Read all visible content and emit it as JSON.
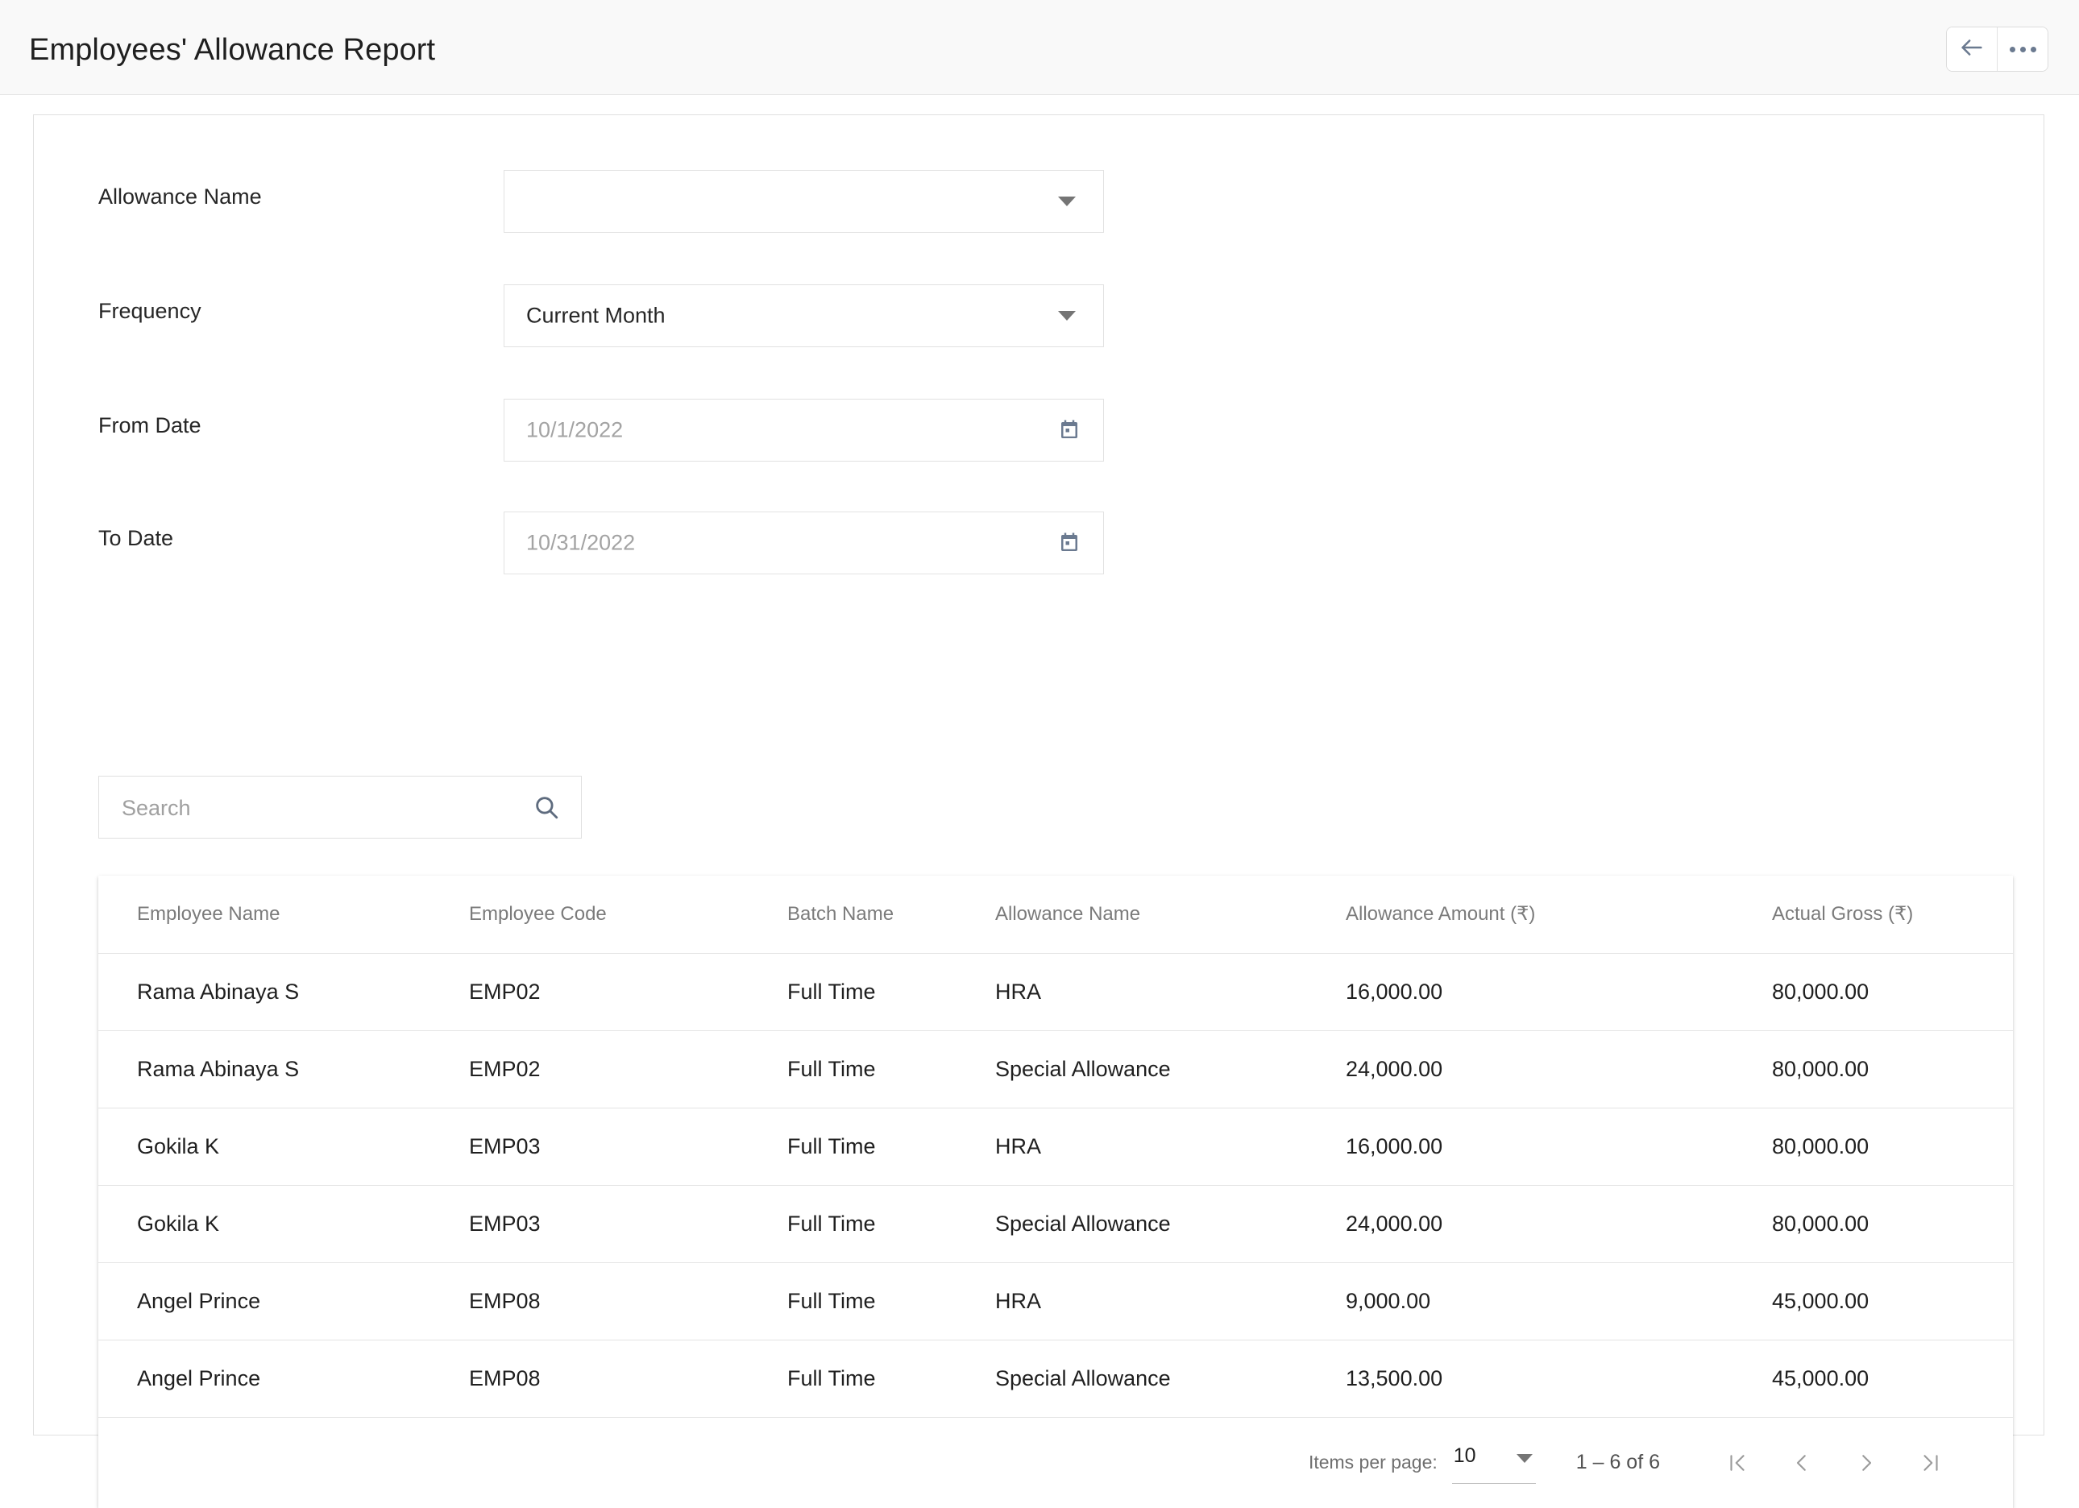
{
  "header": {
    "title": "Employees' Allowance Report",
    "back_button": "back-arrow",
    "more_button": "more-options"
  },
  "filters": [
    {
      "label": "Allowance Name",
      "type": "select",
      "value": "",
      "placeholder": ""
    },
    {
      "label": "Frequency",
      "type": "select",
      "value": "Current Month",
      "placeholder": ""
    },
    {
      "label": "From Date",
      "type": "date",
      "value": "",
      "placeholder": "10/1/2022"
    },
    {
      "label": "To Date",
      "type": "date",
      "value": "",
      "placeholder": "10/31/2022"
    }
  ],
  "search": {
    "placeholder": "Search",
    "value": "",
    "icon": "search-icon"
  },
  "table": {
    "columns": [
      "Employee Name",
      "Employee Code",
      "Batch Name",
      "Allowance Name",
      "Allowance Amount (₹)",
      "Actual Gross (₹)"
    ],
    "rows": [
      {
        "employee_name": "Rama Abinaya S",
        "employee_code": "EMP02",
        "batch_name": "Full Time",
        "allowance_name": "HRA",
        "allowance_amount": "16,000.00",
        "actual_gross": "80,000.00"
      },
      {
        "employee_name": "Rama Abinaya S",
        "employee_code": "EMP02",
        "batch_name": "Full Time",
        "allowance_name": "Special Allowance",
        "allowance_amount": "24,000.00",
        "actual_gross": "80,000.00"
      },
      {
        "employee_name": "Gokila K",
        "employee_code": "EMP03",
        "batch_name": "Full Time",
        "allowance_name": "HRA",
        "allowance_amount": "16,000.00",
        "actual_gross": "80,000.00"
      },
      {
        "employee_name": "Gokila K",
        "employee_code": "EMP03",
        "batch_name": "Full Time",
        "allowance_name": "Special Allowance",
        "allowance_amount": "24,000.00",
        "actual_gross": "80,000.00"
      },
      {
        "employee_name": "Angel Prince",
        "employee_code": "EMP08",
        "batch_name": "Full Time",
        "allowance_name": "HRA",
        "allowance_amount": "9,000.00",
        "actual_gross": "45,000.00"
      },
      {
        "employee_name": "Angel Prince",
        "employee_code": "EMP08",
        "batch_name": "Full Time",
        "allowance_name": "Special Allowance",
        "allowance_amount": "13,500.00",
        "actual_gross": "45,000.00"
      }
    ]
  },
  "paginator": {
    "items_per_page_label": "Items per page:",
    "items_per_page_value": "10",
    "range_label": "1 – 6 of 6",
    "first_page": "first-page",
    "prev_page": "previous-page",
    "next_page": "next-page",
    "last_page": "last-page"
  },
  "colors": {
    "page_background": "#ffffff",
    "appbar_background": "#f9f9f9",
    "border": "#e0e0e0",
    "text_primary": "#1f1f1f",
    "text_muted": "#7b7b7b",
    "icon_slate": "#6b7a90"
  }
}
